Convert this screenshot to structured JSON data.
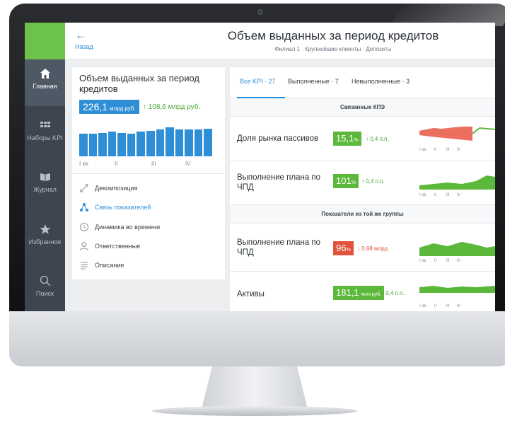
{
  "header": {
    "back_label": "Назад",
    "title": "Объем выданных за период кредитов",
    "subtitle": "Филиал 1 · Крупнейшие клиенты · Депозиты"
  },
  "sidebar": {
    "items": [
      {
        "label": "Главная",
        "icon": "home-icon"
      },
      {
        "label": "Наборы KPI",
        "icon": "grid-icon"
      },
      {
        "label": "Журнал",
        "icon": "book-icon"
      },
      {
        "label": "Избранное",
        "icon": "star-icon"
      },
      {
        "label": "Поиск",
        "icon": "search-icon"
      }
    ]
  },
  "summary_card": {
    "title": "Объем выданных за период кредитов",
    "value": "226,1",
    "unit": "млрд руб.",
    "delta": "↑ 108,6 млрд руб.",
    "bars": [
      0.72,
      0.72,
      0.76,
      0.79,
      0.76,
      0.72,
      0.79,
      0.81,
      0.86,
      0.93,
      0.86,
      0.86,
      0.86,
      0.89
    ],
    "quarters": [
      "I кв.",
      "II",
      "III",
      "IV"
    ],
    "menu": [
      {
        "label": "Декомпозиция",
        "icon": "decomposition-icon"
      },
      {
        "label": "Связь показателей",
        "icon": "link-icon"
      },
      {
        "label": "Динамика во времени",
        "icon": "clock-icon"
      },
      {
        "label": "Ответственные",
        "icon": "person-icon"
      },
      {
        "label": "Описание",
        "icon": "lines-icon"
      }
    ]
  },
  "tabs": [
    {
      "label": "Все KPI · 27"
    },
    {
      "label": "Выполненные · 7"
    },
    {
      "label": "Невыполненные · 3"
    }
  ],
  "sections": {
    "related": "Связанные КПЭ",
    "same_group": "Показатели из той же группы"
  },
  "kpi_rows": [
    {
      "label": "Доля рынка пассивов",
      "value": "15,1",
      "suffix": "%",
      "status": "green",
      "delta": "↑ 0,4 п.п."
    },
    {
      "label": "Выполнение плана по ЧПД",
      "value": "101",
      "suffix": "%",
      "status": "green",
      "delta": "↑ 0,4 п.п."
    },
    {
      "label": "Выполнение плана по ЧПД",
      "value": "96",
      "suffix": "%",
      "status": "red",
      "delta": "↓ 0,98 млрд"
    },
    {
      "label": "Активы",
      "value": "181,1",
      "suffix": "млн руб.",
      "status": "green",
      "delta": "↑ 0,4 п.п."
    }
  ],
  "spark_axis": [
    "I кв.",
    "II",
    "III",
    "IV"
  ],
  "colors": {
    "green": "#5cb83a",
    "red": "#e2523d",
    "blue": "#2e8fd6",
    "sidebar": "#3c4550"
  }
}
